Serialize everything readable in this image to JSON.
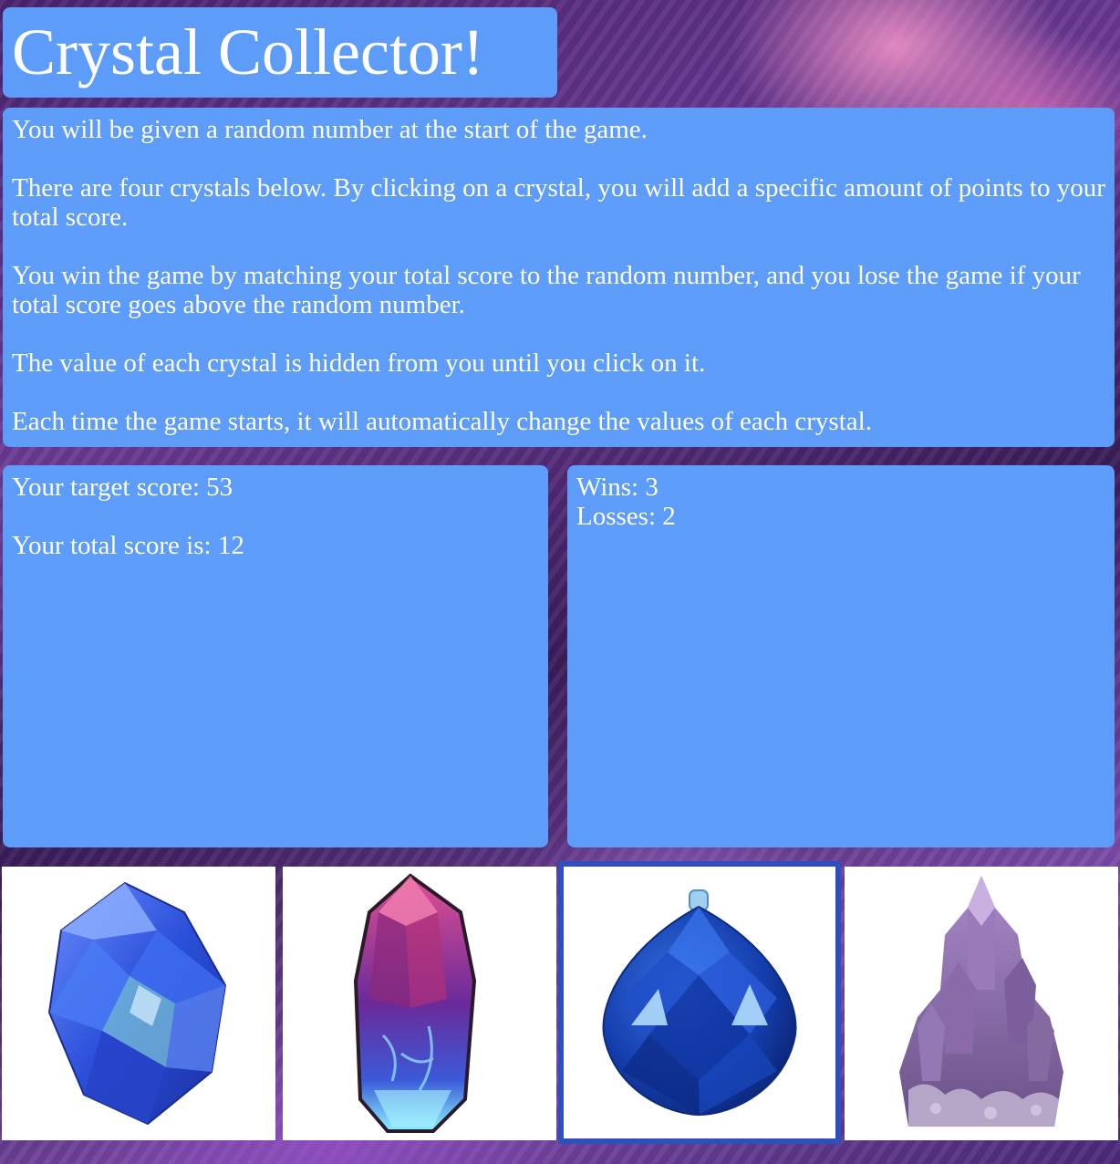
{
  "header": {
    "title": "Crystal Collector!"
  },
  "instructions": [
    "You will be given a random number at the start of the game.",
    "There are four crystals below. By clicking on a crystal, you will add a specific amount of points to your total score.",
    "You win the game by matching your total score to the random number, and you lose the game if your total score goes above the random number.",
    "The value of each crystal is hidden from you until you click on it.",
    "Each time the game starts, it will automatically change the values of each crystal."
  ],
  "score": {
    "target_label": "Your target score: 53",
    "total_label": "Your total score is: 12",
    "target": 53,
    "total": 12
  },
  "stats": {
    "wins_label": "Wins: 3",
    "losses_label": "Losses: 2",
    "wins": 3,
    "losses": 2
  },
  "crystals": [
    {
      "icon": "blue-crystal-icon",
      "color": "#3b5fe0"
    },
    {
      "icon": "pink-crystal-icon",
      "color": "#a0306a"
    },
    {
      "icon": "blue-faceted-ball-icon",
      "color": "#1740b8",
      "selected": true
    },
    {
      "icon": "amethyst-cluster-icon",
      "color": "#8a6aa8"
    }
  ],
  "colors": {
    "panel": "#5e9cf9",
    "text": "#ffffff"
  }
}
